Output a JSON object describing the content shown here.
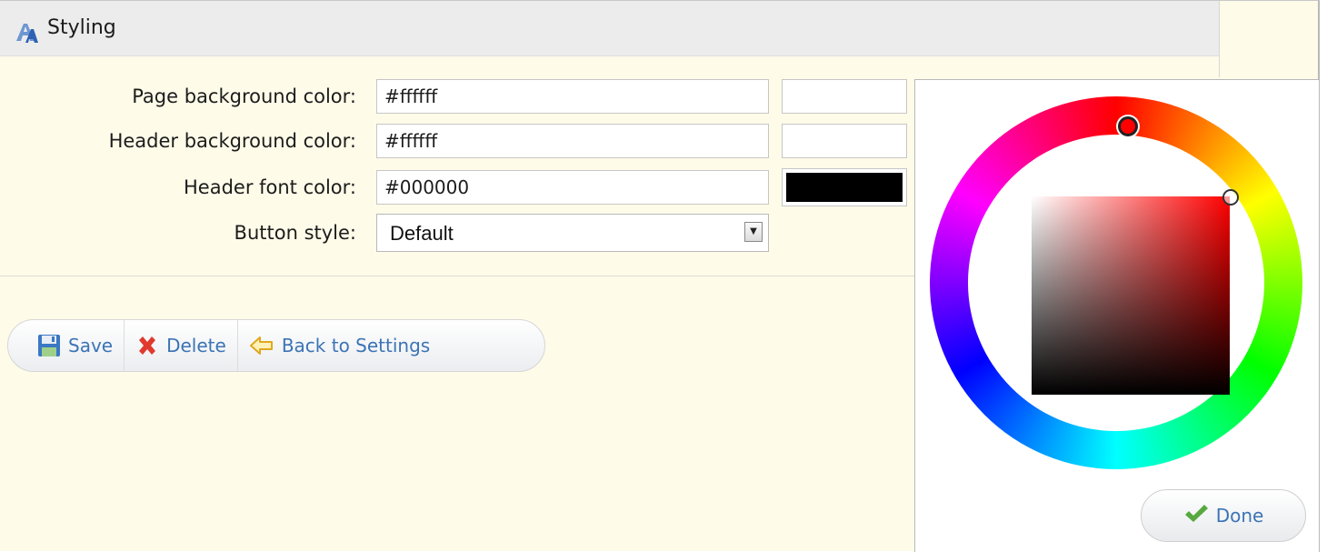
{
  "section": {
    "title": "Styling",
    "icon": "styling-icon"
  },
  "fields": {
    "page_bg": {
      "label": "Page background color:",
      "value": "#ffffff",
      "swatch": "#ffffff"
    },
    "header_bg": {
      "label": "Header background color:",
      "value": "#ffffff",
      "swatch": "#ffffff"
    },
    "header_font": {
      "label": "Header font color:",
      "value": "#000000",
      "swatch": "#000000"
    },
    "button_style": {
      "label": "Button style:",
      "value": "Default"
    }
  },
  "actions": {
    "save": {
      "label": "Save",
      "icon": "floppy-disk-icon"
    },
    "delete": {
      "label": "Delete",
      "icon": "red-x-icon"
    },
    "back": {
      "label": "Back to Settings",
      "icon": "back-arrow-icon"
    }
  },
  "color_picker": {
    "selected_hue": "#ff0000",
    "done_label": "Done",
    "done_icon": "checkmark-icon"
  },
  "colors": {
    "panel_bg": "#fffbe9",
    "header_bar": "#ececec",
    "link_blue": "#3c74b5"
  }
}
